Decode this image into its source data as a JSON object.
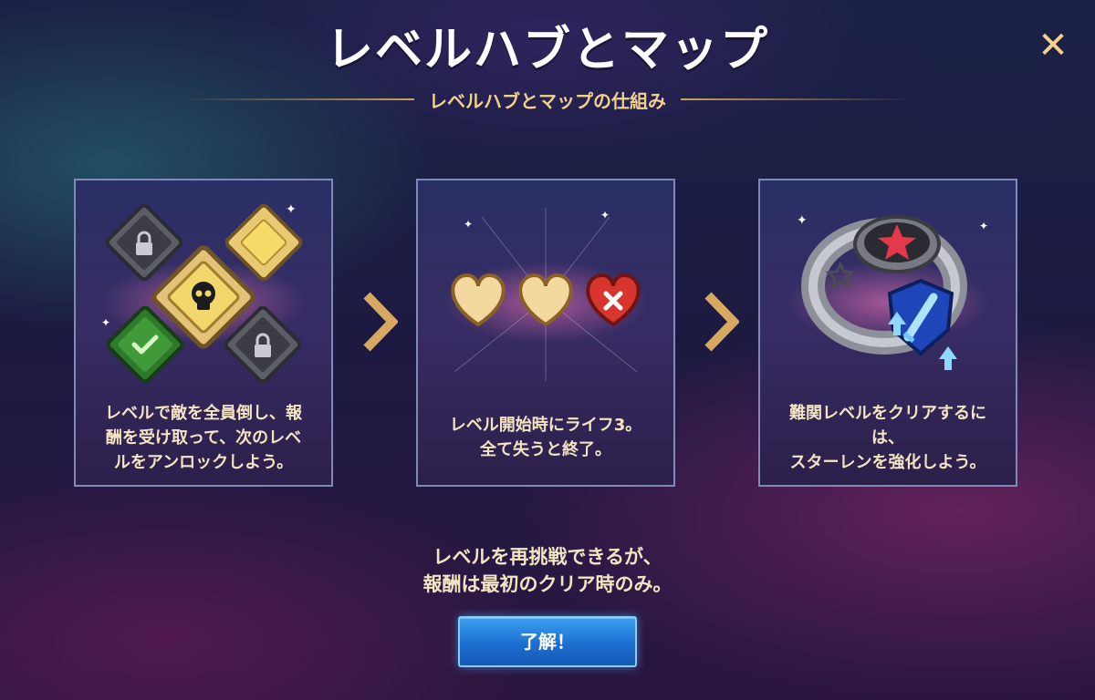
{
  "title": "レベルハブとマップ",
  "subtitle": "レベルハブとマップの仕組み",
  "cards": [
    {
      "text": "レベルで敵を全員倒し、報\n酬を受け取って、次のレベ\nルをアンロックしよう。"
    },
    {
      "text": "レベル開始時にライフ3。\n全て失うと終了。"
    },
    {
      "text": "難関レベルをクリアするに\nは、\nスターレンを強化しよう。"
    }
  ],
  "note_line1": "レベルを再挑戦できるが、",
  "note_line2": "報酬は最初のクリア時のみ。",
  "ok_button": "了解！",
  "close_icon": "close-icon",
  "colors": {
    "accent_gold": "#f2d18d",
    "button_blue": "#1d6fd2",
    "heart_lost": "#d9352f"
  }
}
